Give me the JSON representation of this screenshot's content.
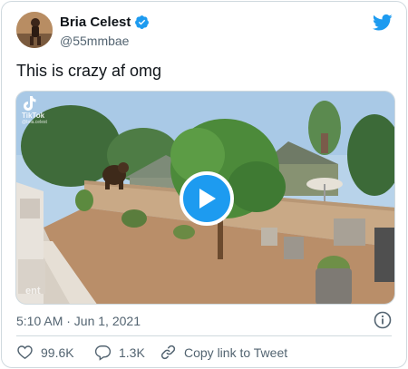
{
  "author": {
    "display_name": "Bria Celest",
    "handle": "@55mmbae",
    "verified": true
  },
  "tweet": {
    "text": "This is crazy af omg",
    "timestamp": "5:10 AM · Jun 1, 2021"
  },
  "media": {
    "type": "video",
    "watermark_top": "TikTok",
    "watermark_handle": "@bria.celest",
    "watermark_bottom": "ent"
  },
  "actions": {
    "likes": "99.6K",
    "replies": "1.3K",
    "copy_link": "Copy link to Tweet"
  },
  "icons": {
    "brand": "twitter-bird-icon",
    "verified": "verified-badge-icon",
    "play": "play-icon",
    "info": "info-icon",
    "like": "heart-icon",
    "reply": "reply-bubble-icon",
    "copy": "link-icon"
  },
  "colors": {
    "accent": "#1d9bf0",
    "text_primary": "#0f1419",
    "text_secondary": "#536471",
    "border": "#cfd9de"
  }
}
